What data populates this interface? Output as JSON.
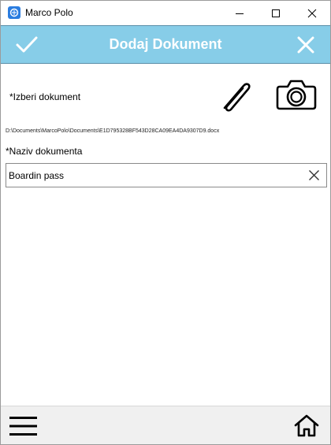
{
  "window": {
    "title": "Marco Polo",
    "icon": "marco-polo-app-icon",
    "controls": [
      "minimize-icon",
      "maximize-icon",
      "close-icon"
    ]
  },
  "header": {
    "title": "Dodaj Dokument",
    "background": "#87cde8",
    "confirm_icon": "checkmark-icon",
    "cancel_icon": "close-icon"
  },
  "document": {
    "select_label": "*Izberi dokument",
    "attach_icon": "paperclip-icon",
    "camera_icon": "camera-icon",
    "file_path": "D:\\Documents\\MarcoPolo\\Documents\\E1D795328BF543D28CA09EA4DA9307D9.docx",
    "name_label": "*Naziv dokumenta",
    "name_value": "Boardin pass",
    "clear_icon": "clear-x-icon"
  },
  "bottom_bar": {
    "menu_icon": "hamburger-menu-icon",
    "home_icon": "home-icon",
    "background": "#f0f0f0"
  }
}
